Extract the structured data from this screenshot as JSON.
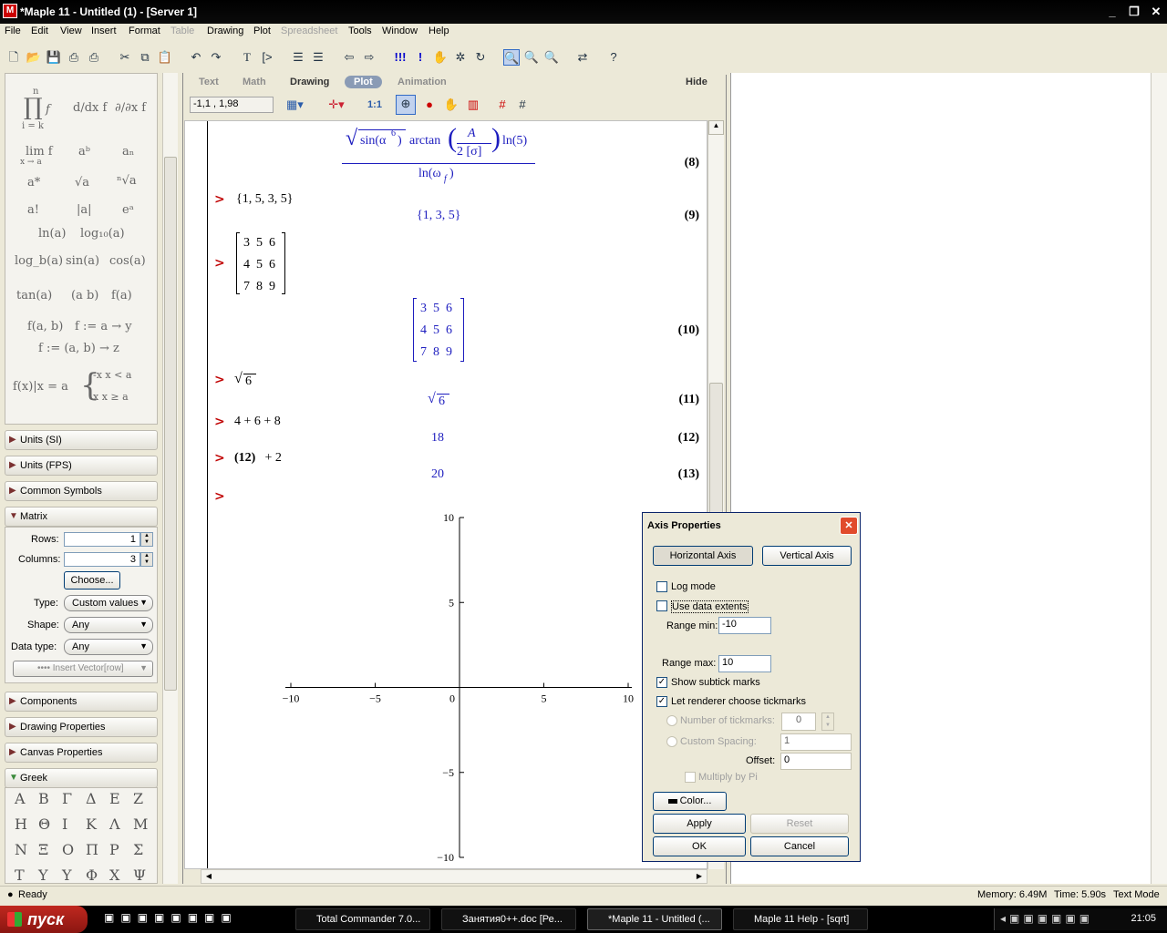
{
  "window": {
    "title": "*Maple 11 - Untitled (1) - [Server 1]"
  },
  "menu": [
    "File",
    "Edit",
    "View",
    "Insert",
    "Format",
    "Table",
    "Drawing",
    "Plot",
    "Spreadsheet",
    "Tools",
    "Window",
    "Help"
  ],
  "palette": {
    "symbols": {
      "prod": "∏",
      "prod_top": "n",
      "prod_bottom": "i = k",
      "prod_f": "f",
      "ddx": "d/dx f",
      "partial": "∂/∂x f",
      "lim": "lim f",
      "lim_sub": "x → a",
      "a_pow_b": "aᵇ",
      "a_sub_n": "aₙ",
      "a_star": "a*",
      "sqrt_a": "√a",
      "nroot_a": "ⁿ√a",
      "fact": "a!",
      "abs": "|a|",
      "exp": "eᵃ",
      "ln": "ln(a)",
      "log10": "log₁₀(a)",
      "logb": "log_b(a)",
      "sin": "sin(a)",
      "cos": "cos(a)",
      "tan": "tan(a)",
      "binom": "(a b)",
      "fa": "f(a)",
      "fab": "f(a, b)",
      "arrow1": "f := a → y",
      "arrow2": "f := (a, b) → z",
      "eval": "f(x)|x = a",
      "piece1": "-x   x < a",
      "piece2": "x   x ≥ a"
    },
    "sections": {
      "units_si": "Units (SI)",
      "units_fps": "Units (FPS)",
      "common_symbols": "Common Symbols",
      "matrix": "Matrix",
      "components": "Components",
      "drawing_properties": "Drawing Properties",
      "canvas_properties": "Canvas Properties",
      "greek": "Greek"
    },
    "matrix": {
      "rows_label": "Rows:",
      "rows_value": "1",
      "columns_label": "Columns:",
      "columns_value": "3",
      "choose_label": "Choose...",
      "type_label": "Type:",
      "type_value": "Custom values",
      "shape_label": "Shape:",
      "shape_value": "Any",
      "datatype_label": "Data type:",
      "datatype_value": "Any",
      "insert_label": "•••• Insert Vector[row]"
    },
    "greek_rows": [
      [
        "Α",
        "Β",
        "Γ",
        "Δ",
        "Ε",
        "Ζ"
      ],
      [
        "Η",
        "Θ",
        "Ι",
        "Κ",
        "Λ",
        "Μ"
      ],
      [
        "Ν",
        "Ξ",
        "Ο",
        "Π",
        "Ρ",
        "Σ"
      ],
      [
        "Τ",
        "Υ",
        "Υ",
        "Φ",
        "Χ",
        "Ψ"
      ]
    ]
  },
  "context_bar": {
    "tabs": [
      "Text",
      "Math",
      "Drawing",
      "Plot",
      "Animation"
    ],
    "active_tab": "Plot",
    "hide_label": "Hide",
    "coords_value": "-1,1 , 1,98",
    "ratio_label": "1:1"
  },
  "worksheet": {
    "eq8_expr": "√(sin(α⁶)) arctan(A / 2[σ]) ln(5) / ln(ω_f)",
    "eq8_num_sqrt": "sin(α",
    "eq8_num_exp": "6",
    "eq8_num_arctan": "arctan",
    "eq8_frac_top": "A",
    "eq8_frac_bottom": "2 [σ]",
    "eq8_ln5": "ln(5)",
    "eq8_den": "ln(ω",
    "eq8_den_sub": "f",
    "eq8_num": "(8)",
    "in9": "{1, 5, 3, 5}",
    "out9": "{1, 3, 5}",
    "eq9": "(9)",
    "matrix_in": [
      [
        "3",
        "5",
        "6"
      ],
      [
        "4",
        "5",
        "6"
      ],
      [
        "7",
        "8",
        "9"
      ]
    ],
    "matrix_out": [
      [
        "3",
        "5",
        "6"
      ],
      [
        "4",
        "5",
        "6"
      ],
      [
        "7",
        "8",
        "9"
      ]
    ],
    "eq10": "(10)",
    "in11": "6",
    "out11": "6",
    "eq11": "(11)",
    "in12": "4 + 6 + 8",
    "out12": "18",
    "eq12": "(12)",
    "in13_bold": "(12)",
    "in13_rest": " + 2",
    "out13": "20",
    "eq13": "(13)",
    "prompt": ">"
  },
  "plot": {
    "x_ticks": [
      "−10",
      "−5",
      "0",
      "5",
      "10"
    ],
    "y_ticks": [
      "10",
      "5",
      "−5",
      "−10"
    ],
    "xlim": [
      -10,
      10
    ],
    "ylim": [
      -10,
      10
    ]
  },
  "dialog": {
    "title": "Axis Properties",
    "horizontal_axis": "Horizontal Axis",
    "vertical_axis": "Vertical Axis",
    "log_mode": "Log mode",
    "use_data_extents": "Use data extents",
    "range_min_label": "Range min:",
    "range_min_value": "-10",
    "range_max_label": "Range max:",
    "range_max_value": "10",
    "show_subtick": "Show subtick marks",
    "let_renderer": "Let renderer choose tickmarks",
    "num_tickmarks_label": "Number of tickmarks:",
    "num_tickmarks_value": "0",
    "custom_spacing_label": "Custom Spacing:",
    "custom_spacing_value": "1",
    "offset_label": "Offset:",
    "offset_value": "0",
    "multiply_pi": "Multiply by Pi",
    "color_label": "Color...",
    "apply_label": "Apply",
    "reset_label": "Reset",
    "ok_label": "OK",
    "cancel_label": "Cancel"
  },
  "status": {
    "ready": "Ready",
    "memory": "Memory: 6.49M",
    "time": "Time: 5.90s",
    "mode": "Text Mode"
  },
  "taskbar": {
    "start": "пуск",
    "tasks": [
      "Total Commander 7.0...",
      "Занятия0++.doc [Ре...",
      "*Maple 11 - Untitled (...",
      "Maple 11 Help - [sqrt]"
    ],
    "clock": "21:05"
  }
}
